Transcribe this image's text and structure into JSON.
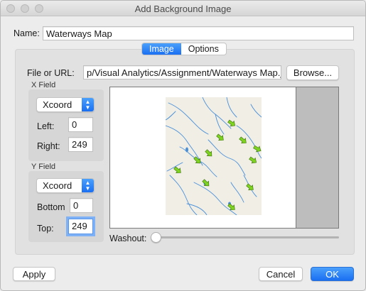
{
  "window": {
    "title": "Add Background Image"
  },
  "name_field": {
    "label": "Name:",
    "value": "Waterways Map"
  },
  "tabs": [
    {
      "label": "Image",
      "active": true
    },
    {
      "label": "Options",
      "active": false
    }
  ],
  "file": {
    "label": "File or URL:",
    "value": "p/Visual Analytics/Assignment/Waterways Map.jpg",
    "browse_label": "Browse..."
  },
  "x_field": {
    "group_label": "X Field",
    "selected": "Xcoord",
    "left_label": "Left:",
    "left_value": "0",
    "right_label": "Right:",
    "right_value": "249"
  },
  "y_field": {
    "group_label": "Y Field",
    "selected": "Xcoord",
    "bottom_label": "Bottom",
    "bottom_value": "0",
    "top_label": "Top:",
    "top_value": "249"
  },
  "washout": {
    "label": "Washout:",
    "value": 0
  },
  "buttons": {
    "apply": "Apply",
    "cancel": "Cancel",
    "ok": "OK"
  },
  "colors": {
    "accent": "#1a6ff2",
    "marker": "#7ed321",
    "river": "#4a90d9",
    "map_bg": "#f1eee6"
  },
  "icons": {
    "marker": "green-arrow-marker-icon"
  }
}
